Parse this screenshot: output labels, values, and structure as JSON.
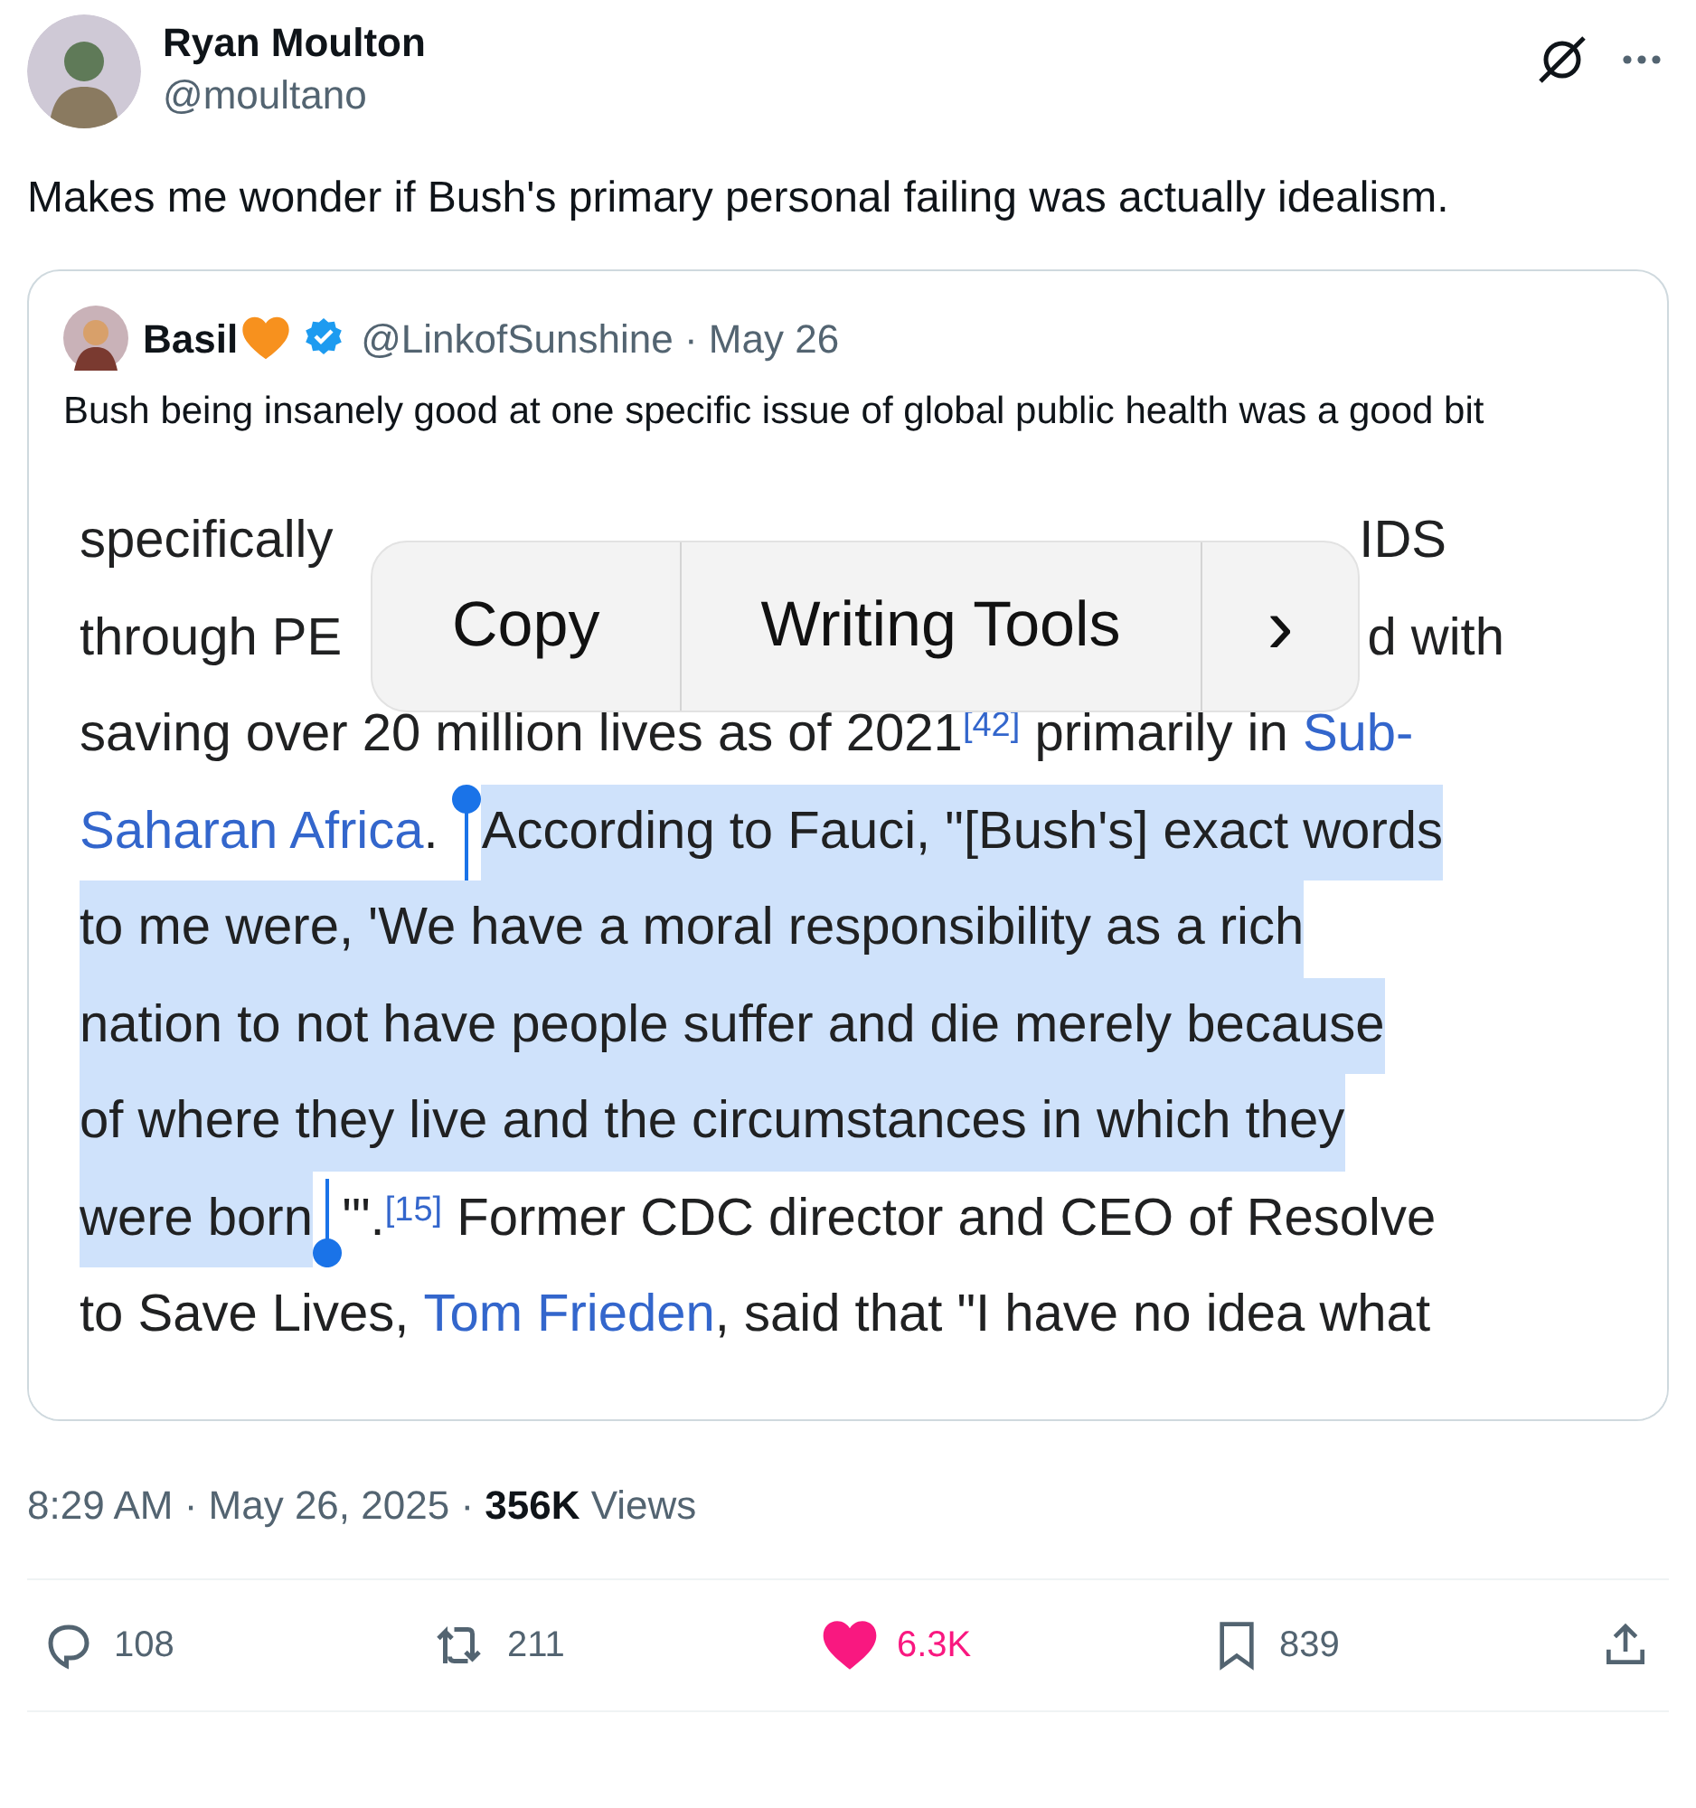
{
  "author": {
    "name": "Ryan Moulton",
    "handle": "@moultano"
  },
  "text": "Makes me wonder if Bush's primary personal failing was actually idealism.",
  "quote": {
    "name": "Basil",
    "handle": "@LinkofSunshine · May 26",
    "text": "Bush being insanely good at one specific issue of global public health was a good bit",
    "lines": [
      {
        "segments": [
          {
            "kind": "plain",
            "text": "specifically",
            "selected": false
          },
          {
            "kind": "gap"
          },
          {
            "kind": "plain",
            "text": "IDS",
            "selected": false
          }
        ]
      },
      {
        "segments": [
          {
            "kind": "plain",
            "text": "through PE",
            "selected": false
          },
          {
            "kind": "gap"
          },
          {
            "kind": "plain",
            "text": "d with",
            "selected": false
          }
        ]
      },
      {
        "segments": [
          {
            "kind": "plain",
            "text": "saving over 20 million lives as of 2021",
            "selected": false
          },
          {
            "kind": "sup",
            "text": "[42]",
            "selected": false
          },
          {
            "kind": "plain",
            "text": " primarily in ",
            "selected": false
          },
          {
            "kind": "link",
            "text": "Sub-",
            "selected": false
          }
        ]
      },
      {
        "segments": [
          {
            "kind": "link",
            "text": "Saharan Africa",
            "selected": false
          },
          {
            "kind": "plain",
            "text": ". ",
            "selected": false
          },
          {
            "kind": "plain",
            "text": "According to Fauci, \"[Bush's] exact words",
            "selected": true
          }
        ]
      },
      {
        "segments": [
          {
            "kind": "plain",
            "text": "to me were, 'We have a moral responsibility as a rich",
            "selected": true
          }
        ]
      },
      {
        "segments": [
          {
            "kind": "plain",
            "text": "nation to not have people suffer and die merely because",
            "selected": true
          }
        ]
      },
      {
        "segments": [
          {
            "kind": "plain",
            "text": "of where they live and the circumstances in which they",
            "selected": true
          }
        ]
      },
      {
        "segments": [
          {
            "kind": "plain",
            "text": "were born",
            "selected": true
          },
          {
            "kind": "plain",
            "text": "'\".",
            "selected": false
          },
          {
            "kind": "sup",
            "text": "[15]",
            "selected": false
          },
          {
            "kind": "plain",
            "text": " Former CDC director and CEO of Resolve",
            "selected": false
          }
        ]
      },
      {
        "segments": [
          {
            "kind": "plain",
            "text": "to Save Lives, ",
            "selected": false
          },
          {
            "kind": "link",
            "text": "Tom Frieden",
            "selected": false
          },
          {
            "kind": "plain",
            "text": ", said that \"I have no idea what",
            "selected": false
          }
        ]
      }
    ],
    "menu": [
      "Copy",
      "Writing Tools",
      "›"
    ]
  },
  "meta": {
    "time": "8:29 AM · May 26, 2025 · ",
    "views_count": "356K",
    "views_label": " Views"
  },
  "actions": [
    {
      "kind": "reply",
      "count": "108"
    },
    {
      "kind": "retweet",
      "count": "211"
    },
    {
      "kind": "like",
      "count": "6.3K",
      "liked": true
    },
    {
      "kind": "bookmark",
      "count": "839"
    },
    {
      "kind": "share"
    }
  ]
}
